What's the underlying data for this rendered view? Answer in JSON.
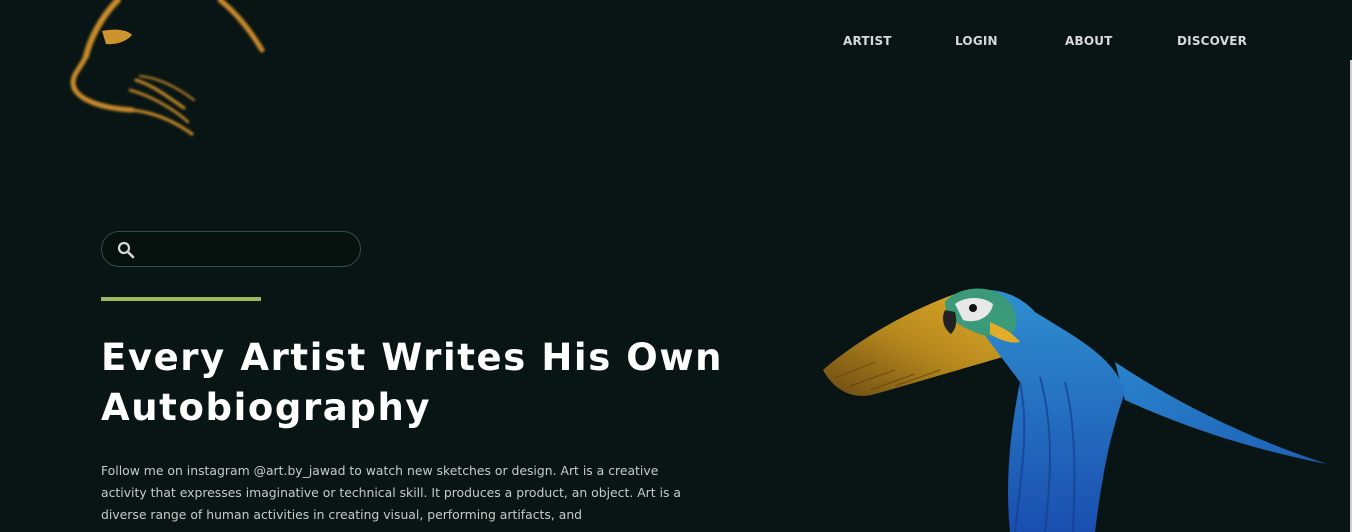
{
  "nav": {
    "items": [
      {
        "label": "ARTIST"
      },
      {
        "label": "LOGIN"
      },
      {
        "label": "ABOUT"
      },
      {
        "label": "DISCOVER"
      }
    ]
  },
  "logo": {
    "icon": "cat-logo-icon",
    "color": "#d89a2e"
  },
  "search": {
    "placeholder": "",
    "value": "",
    "icon": "search-icon"
  },
  "hero": {
    "headline_line1": "Every Artist Writes His Own",
    "headline_line2": "Autobiography",
    "description": "Follow me on instagram @art.by_jawad to watch new sketches or design. Art is a creative activity that expresses imaginative or technical skill. It produces a product, an object. Art is a diverse range of human activities in creating visual, performing artifacts, and"
  },
  "colors": {
    "background": "#081514",
    "accent": "#9cb85a",
    "nav_text": "#d9d9d9",
    "headline": "#ffffff",
    "body_text": "#c6ccc9"
  },
  "image": {
    "icon": "macaw-parrot-image"
  }
}
